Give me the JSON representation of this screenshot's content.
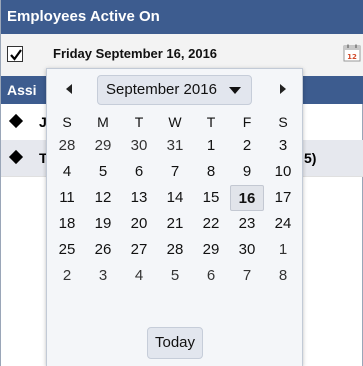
{
  "header": {
    "title": "Employees Active On"
  },
  "date_row": {
    "checked": true,
    "date_label": "Friday September 16, 2016",
    "calendar_icon_number": "12"
  },
  "section": {
    "title": "Assi"
  },
  "rows": [
    {
      "text": "Jo",
      "tail": ""
    },
    {
      "text": "T",
      "tail": "5)"
    }
  ],
  "datepicker": {
    "month_label": "September 2016",
    "weekdays": [
      "S",
      "M",
      "T",
      "W",
      "T",
      "F",
      "S"
    ],
    "weeks": [
      [
        "28",
        "29",
        "30",
        "31",
        "1",
        "2",
        "3"
      ],
      [
        "4",
        "5",
        "6",
        "7",
        "8",
        "9",
        "10"
      ],
      [
        "11",
        "12",
        "13",
        "14",
        "15",
        "16",
        "17"
      ],
      [
        "18",
        "19",
        "20",
        "21",
        "22",
        "23",
        "24"
      ],
      [
        "25",
        "26",
        "27",
        "28",
        "29",
        "30",
        "1"
      ],
      [
        "2",
        "3",
        "4",
        "5",
        "6",
        "7",
        "8"
      ]
    ],
    "selected_day": "16",
    "today_label": "Today"
  }
}
